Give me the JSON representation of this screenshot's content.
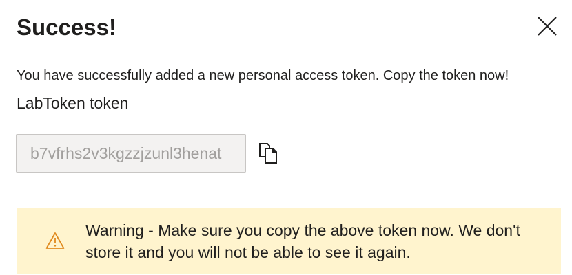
{
  "dialog": {
    "title": "Success!",
    "message": "You have successfully added a new personal access token. Copy the token now!",
    "token_name": "LabToken token",
    "token_value": "b7vfrhs2v3kgzzjzunl3henat",
    "close_icon": "close-icon",
    "copy_icon": "copy-icon"
  },
  "warning": {
    "icon": "warning-icon",
    "text": "Warning - Make sure you copy the above token now. We don't store it and you will not be able to see it again."
  },
  "colors": {
    "warning_background": "#fff4ce",
    "warning_icon": "#e08a1e",
    "field_background": "#f3f2f1",
    "field_border": "#c8c6c4",
    "field_text": "#a19f9d",
    "text": "#201f1e"
  }
}
